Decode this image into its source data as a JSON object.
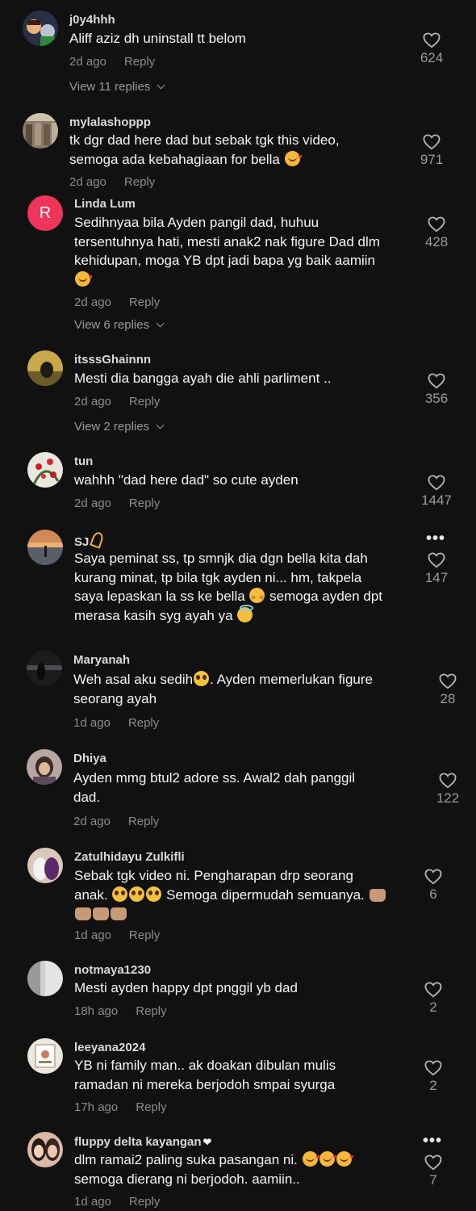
{
  "comments": [
    {
      "username": "j0y4hhh",
      "text_lines": [
        "Aliff aziz dh uninstall tt belom"
      ],
      "time": "2d ago",
      "reply_label": "Reply",
      "likes": "624",
      "view_replies": "View 11 replies",
      "avatar": "cartoon-avatar"
    },
    {
      "username": "mylalashoppp",
      "text_lines": [
        "tk dgr dad here dad but sebak tgk this video,",
        "semoga ada kebahagiaan for bella"
      ],
      "time": "2d ago",
      "reply_label": "Reply",
      "likes": "971",
      "avatar": "photo-avatar"
    },
    {
      "username": "Linda Lum",
      "avatar_letter": "R",
      "text_lines": [
        "Sedihnyaa bila Ayden pangil dad, huhuu",
        "tersentuhnya hati, mesti anak2 nak figure Dad dlm",
        "kehidupan, moga YB dpt jadi bapa yg baik aamiin",
        ""
      ],
      "time": "2d ago",
      "reply_label": "Reply",
      "likes": "428",
      "view_replies": "View 6 replies"
    },
    {
      "username": "itsssGhainnn",
      "text_lines": [
        "Mesti dia bangga ayah die ahli parliment .."
      ],
      "time": "2d ago",
      "reply_label": "Reply",
      "likes": "356",
      "view_replies": "View 2 replies",
      "avatar": "photo-avatar"
    },
    {
      "username": "tun",
      "text_lines": [
        "wahhh \"dad here dad\" so cute ayden"
      ],
      "time": "2d ago",
      "reply_label": "Reply",
      "likes": "1447",
      "avatar": "flower-avatar"
    },
    {
      "username": "SJ",
      "text_lines": [
        "Saya peminat ss, tp smnjk dia dgn bella kita dah",
        "kurang minat, tp bila tgk ayden ni... hm, takpela",
        "saya lepaskan la ss ke bella",
        "merasa kasih syg ayah ya"
      ],
      "text_tail_3": "semoga ayden dpt",
      "likes": "147",
      "avatar": "sunset-avatar"
    },
    {
      "username": "Maryanah",
      "text_lines": [
        "Weh asal aku sedih",
        "seorang ayah"
      ],
      "text_tail_1": ". Ayden memerlukan figure",
      "time": "1d ago",
      "reply_label": "Reply",
      "likes": "28",
      "avatar": "photo-avatar"
    },
    {
      "username": "Dhiya",
      "text_lines": [
        "Ayden mmg btul2 adore ss. Awal2 dah panggil",
        "dad."
      ],
      "time": "2d ago",
      "reply_label": "Reply",
      "likes": "122",
      "avatar": "photo-avatar"
    },
    {
      "username": "Zatulhidayu Zulkifli",
      "text_lines": [
        "Sebak tgk video ni. Pengharapan drp seorang",
        "anak.",
        ""
      ],
      "text_tail_2": "Semoga dipermudah semuanya.",
      "time": "1d ago",
      "reply_label": "Reply",
      "likes": "6",
      "avatar": "photo-avatar"
    },
    {
      "username": "notmaya1230",
      "text_lines": [
        "Mesti ayden happy dpt pnggil yb dad"
      ],
      "time": "18h ago",
      "reply_label": "Reply",
      "likes": "2",
      "avatar": "photo-avatar"
    },
    {
      "username": "leeyana2024",
      "text_lines": [
        "YB ni family man.. ak doakan dibulan mulis",
        "ramadan ni mereka berjodoh smpai syurga"
      ],
      "time": "17h ago",
      "reply_label": "Reply",
      "likes": "2",
      "avatar": "photo-avatar"
    },
    {
      "username": "fluppy delta kayangan",
      "text_lines": [
        "dlm ramai2 paling suka pasangan ni.",
        "semoga dierang ni berjodoh. aamiin.."
      ],
      "time": "1d ago",
      "reply_label": "Reply",
      "likes": "7",
      "avatar": "photo-avatar"
    }
  ],
  "more_options_icon": "more-options-icon",
  "like_icon": "heart-outline-icon",
  "colors": {
    "background": "#111111",
    "text": "#f4f4f4",
    "muted": "#8c8c8c",
    "avatar_r": "#f0345a"
  }
}
